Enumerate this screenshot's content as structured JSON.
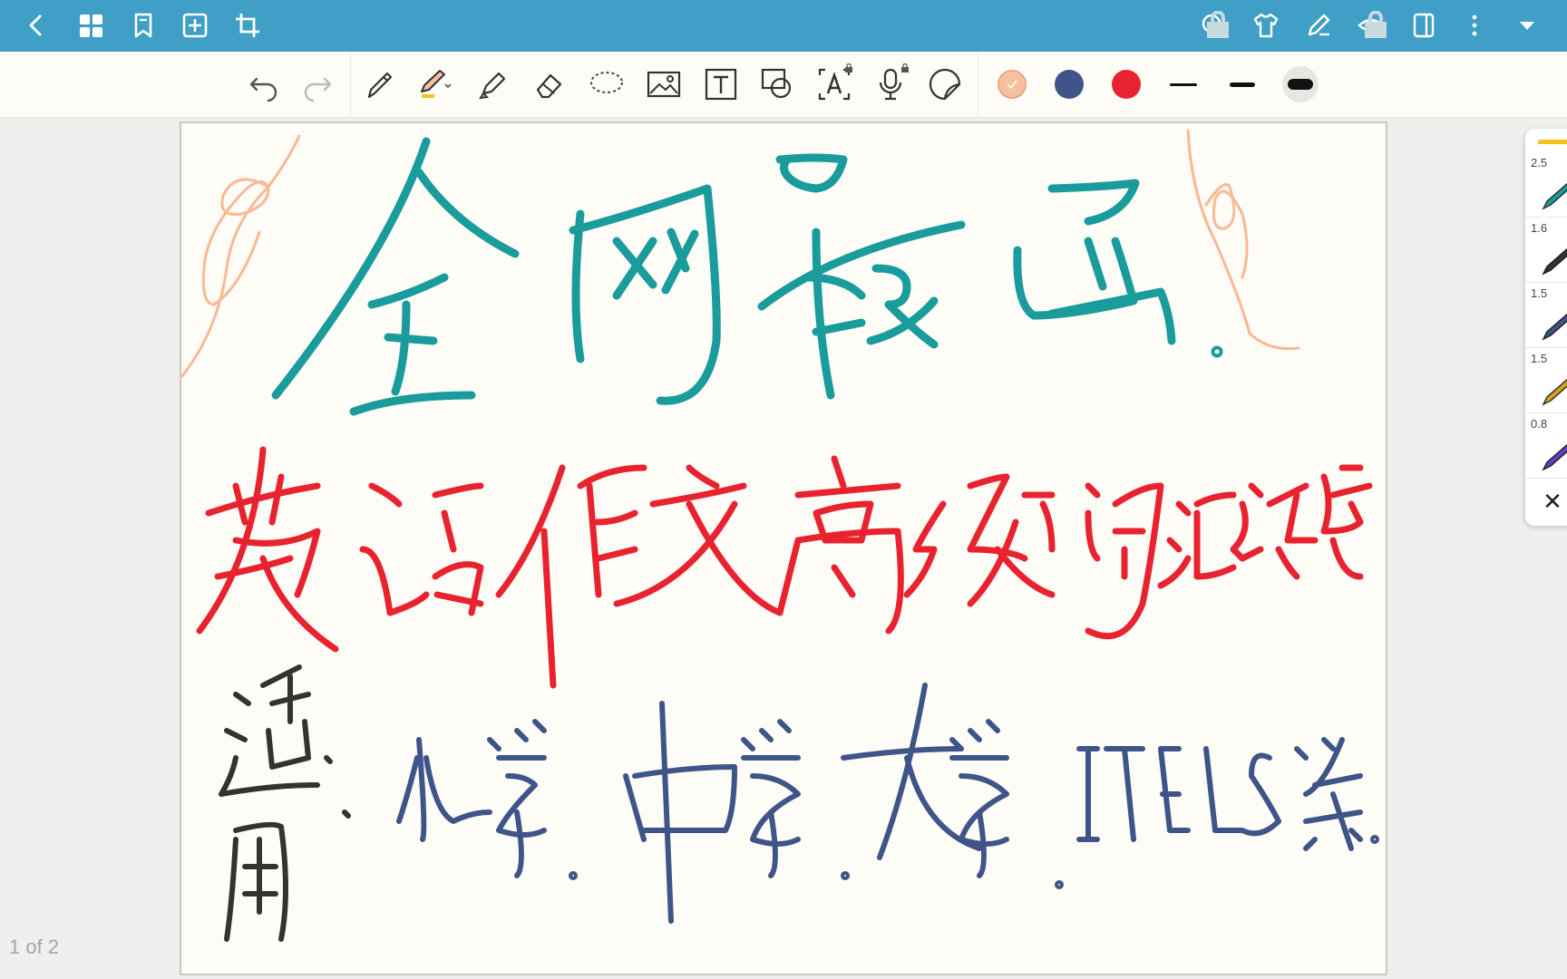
{
  "app": {
    "top_bar_color": "#3f9fc6",
    "top_bar_left_icons": [
      "back-icon",
      "grid-icon",
      "bookmark-icon",
      "add-page-icon",
      "crop-icon"
    ],
    "top_bar_right_icons": [
      "search-icon",
      "shirt-icon",
      "pen-icon",
      "eye-icon",
      "sidebar-icon",
      "more-icon",
      "dropdown-icon"
    ]
  },
  "toolbar": {
    "history_icons": [
      "undo-icon",
      "redo-icon"
    ],
    "tools": [
      "pencil-icon",
      "pen-icon",
      "highlighter-icon",
      "eraser-icon",
      "lasso-icon",
      "image-icon",
      "text-icon",
      "shape-icon",
      "text-recognition-icon",
      "microphone-icon",
      "sticker-icon"
    ],
    "colors": [
      "#f6c0a0",
      "#3f5488",
      "#e8232f"
    ],
    "stroke_widths": [
      "thin",
      "medium",
      "thick"
    ]
  },
  "canvas": {
    "title_color": "#1a9c9c",
    "subtitle_color": "#e8232f",
    "body_color": "#3f5488",
    "ink_color": "#333333",
    "decoration_color": "#f9b995"
  },
  "status": {
    "page_counter": "1 of 2"
  },
  "pen_panel": {
    "accent": "#f3c21b",
    "pens": [
      {
        "size": "2.5",
        "color": "#1a9c9c"
      },
      {
        "size": "1.6",
        "color": "#333333"
      },
      {
        "size": "1.5",
        "color": "#3f5488"
      },
      {
        "size": "1.5",
        "color": "#d9a21b"
      },
      {
        "size": "0.8",
        "color": "#6a3cc9"
      }
    ],
    "close_label": "✕"
  }
}
